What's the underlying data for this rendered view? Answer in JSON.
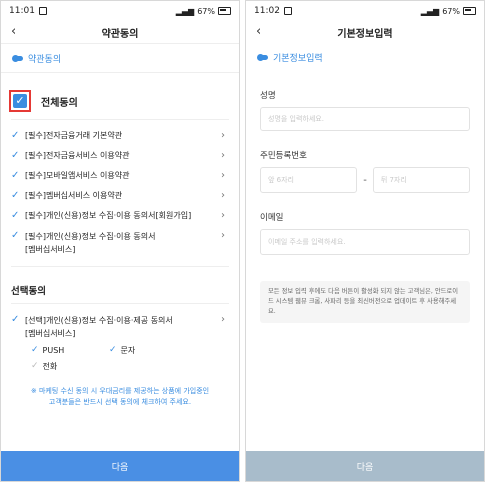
{
  "left": {
    "status": {
      "time": "11:01",
      "battery": "67%"
    },
    "title": "약관동의",
    "section_tag": "약관동의",
    "all_agree": "전체동의",
    "required_items": [
      "[필수]전자금융거래 기본약관",
      "[필수]전자금융서비스 이용약관",
      "[필수]모바일앱서비스 이용약관",
      "[필수]멤버십서비스 이용약관",
      "[필수]개인(신용)정보 수집·이용 동의서[회원가입]"
    ],
    "required_item_6_line1": "[필수]개인(신용)정보 수집·이용 동의서",
    "required_item_6_line2": "[멤버십서비스]",
    "optional_head": "선택동의",
    "optional_item_line1": "[선택]개인(신용)정보 수집·이용·제공 동의서",
    "optional_item_line2": "[멤버십서비스]",
    "opt_push": "PUSH",
    "opt_sms": "문자",
    "opt_call": "전화",
    "notice_line1": "※ 마케팅 수신 동의 시 우대금리를 제공하는 상품에 가입중인",
    "notice_line2": "고객분들은 반드시 선택 동의에 체크하여 주세요.",
    "next": "다음"
  },
  "right": {
    "status": {
      "time": "11:02",
      "battery": "67%"
    },
    "title": "기본정보입력",
    "section_tag": "기본정보입력",
    "name_label": "성명",
    "name_placeholder": "성명을 입력하세요.",
    "rrn_label": "주민등록번호",
    "rrn_front_placeholder": "앞 6자리",
    "rrn_back_placeholder": "뒤 7자리",
    "email_label": "이메일",
    "email_placeholder": "이메일 주소를 입력하세요.",
    "info_text": "모든 정보 입력 후에도 다음 버튼이 활성화 되지 않는 고객님은, 안드로이드 시스템 웹뷰 크롬, 사파리 등을 최신버전으로 업데이트 후 사용해주세요.",
    "next": "다음"
  },
  "colors": {
    "accent": "#3a8de0",
    "button_active": "#4a8fe4",
    "button_disabled": "#a8bccb",
    "highlight": "#e53935"
  }
}
